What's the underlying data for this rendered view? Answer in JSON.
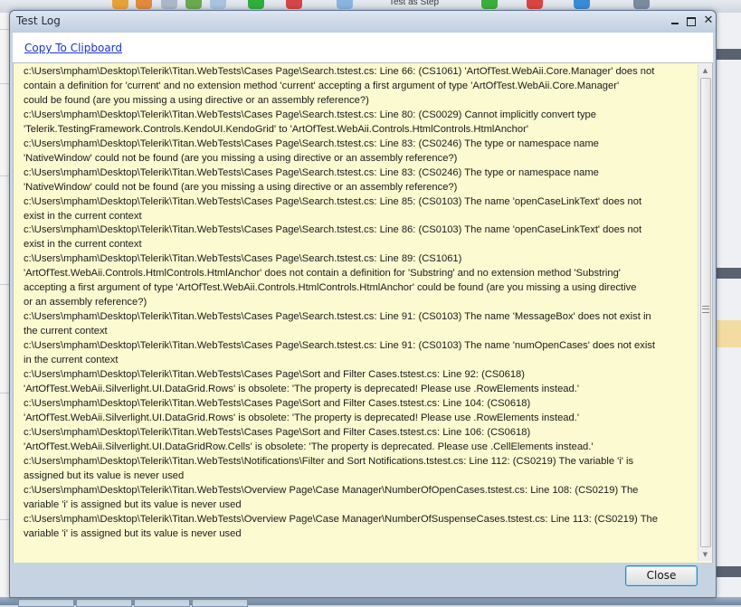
{
  "window": {
    "title": "Test Log",
    "minimize_label": "‒",
    "maximize_label": "□",
    "close_label": "✕"
  },
  "toolbar": {
    "copy_label": "Copy To Clipboard"
  },
  "background": {
    "toolbar_item_label": "Test as Step"
  },
  "log": {
    "lines": [
      "c:\\Users\\mpham\\Desktop\\Telerik\\Titan.WebTests\\Cases Page\\Search.tstest.cs: Line 66: (CS1061) 'ArtOfTest.WebAii.Core.Manager' does not",
      "contain a definition for 'current' and no extension method 'current' accepting a first argument of type 'ArtOfTest.WebAii.Core.Manager'",
      "could be found (are you missing a using directive or an assembly reference?)",
      "c:\\Users\\mpham\\Desktop\\Telerik\\Titan.WebTests\\Cases Page\\Search.tstest.cs: Line 80: (CS0029) Cannot implicitly convert type",
      "'Telerik.TestingFramework.Controls.KendoUI.KendoGrid' to 'ArtOfTest.WebAii.Controls.HtmlControls.HtmlAnchor'",
      "c:\\Users\\mpham\\Desktop\\Telerik\\Titan.WebTests\\Cases Page\\Search.tstest.cs: Line 83: (CS0246) The type or namespace name",
      "'NativeWindow' could not be found (are you missing a using directive or an assembly reference?)",
      "c:\\Users\\mpham\\Desktop\\Telerik\\Titan.WebTests\\Cases Page\\Search.tstest.cs: Line 83: (CS0246) The type or namespace name",
      "'NativeWindow' could not be found (are you missing a using directive or an assembly reference?)",
      "c:\\Users\\mpham\\Desktop\\Telerik\\Titan.WebTests\\Cases Page\\Search.tstest.cs: Line 85: (CS0103) The name 'openCaseLinkText' does not",
      "exist in the current context",
      "c:\\Users\\mpham\\Desktop\\Telerik\\Titan.WebTests\\Cases Page\\Search.tstest.cs: Line 86: (CS0103) The name 'openCaseLinkText' does not",
      "exist in the current context",
      "c:\\Users\\mpham\\Desktop\\Telerik\\Titan.WebTests\\Cases Page\\Search.tstest.cs: Line 89: (CS1061)",
      "'ArtOfTest.WebAii.Controls.HtmlControls.HtmlAnchor' does not contain a definition for 'Substring' and no extension method 'Substring'",
      "accepting a first argument of type 'ArtOfTest.WebAii.Controls.HtmlControls.HtmlAnchor' could be found (are you missing a using directive",
      "or an assembly reference?)",
      "c:\\Users\\mpham\\Desktop\\Telerik\\Titan.WebTests\\Cases Page\\Search.tstest.cs: Line 91: (CS0103) The name 'MessageBox' does not exist in",
      "the current context",
      "c:\\Users\\mpham\\Desktop\\Telerik\\Titan.WebTests\\Cases Page\\Search.tstest.cs: Line 91: (CS0103) The name 'numOpenCases' does not exist",
      "in the current context",
      "c:\\Users\\mpham\\Desktop\\Telerik\\Titan.WebTests\\Cases Page\\Sort and Filter Cases.tstest.cs: Line 92: (CS0618)",
      "'ArtOfTest.WebAii.Silverlight.UI.DataGrid.Rows' is obsolete: 'The property is deprecated! Please use .RowElements instead.'",
      "c:\\Users\\mpham\\Desktop\\Telerik\\Titan.WebTests\\Cases Page\\Sort and Filter Cases.tstest.cs: Line 104: (CS0618)",
      "'ArtOfTest.WebAii.Silverlight.UI.DataGrid.Rows' is obsolete: 'The property is deprecated! Please use .RowElements instead.'",
      "c:\\Users\\mpham\\Desktop\\Telerik\\Titan.WebTests\\Cases Page\\Sort and Filter Cases.tstest.cs: Line 106: (CS0618)",
      "'ArtOfTest.WebAii.Silverlight.UI.DataGridRow.Cells' is obsolete: 'The property is deprecated. Please use .CellElements instead.'",
      "c:\\Users\\mpham\\Desktop\\Telerik\\Titan.WebTests\\Notifications\\Filter and Sort Notifications.tstest.cs: Line 112: (CS0219) The variable 'i' is",
      "assigned but its value is never used",
      "c:\\Users\\mpham\\Desktop\\Telerik\\Titan.WebTests\\Overview Page\\Case Manager\\NumberOfOpenCases.tstest.cs: Line 108: (CS0219) The",
      "variable 'i' is assigned but its value is never used",
      "c:\\Users\\mpham\\Desktop\\Telerik\\Titan.WebTests\\Overview Page\\Case Manager\\NumberOfSuspenseCases.tstest.cs: Line 113: (CS0219) The",
      "variable 'i' is assigned but its value is never used"
    ]
  },
  "footer": {
    "close_label": "Close"
  },
  "colors": {
    "log_background": "#fbfad0",
    "link": "#1a33cc",
    "window_frame": "#c6d3e2"
  }
}
